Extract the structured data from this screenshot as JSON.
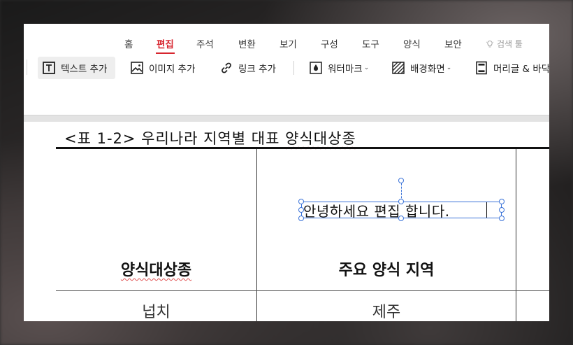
{
  "tabs": [
    {
      "label": "홈"
    },
    {
      "label": "편집"
    },
    {
      "label": "주석"
    },
    {
      "label": "변환"
    },
    {
      "label": "보기"
    },
    {
      "label": "구성"
    },
    {
      "label": "도구"
    },
    {
      "label": "양식"
    },
    {
      "label": "보안"
    }
  ],
  "search_label": "검색 툴",
  "toolbar": {
    "add_text": "텍스트 추가",
    "add_image": "이미지 추가",
    "add_link": "링크 추가",
    "watermark": "워터마크",
    "background": "배경화면",
    "header_footer": "머리글 & 바닥"
  },
  "document": {
    "caption_prefix": "<표 1-2> 우리나라 지역별 대표 ",
    "caption_word": "양식대상종",
    "table": {
      "headers": [
        "양식대상종",
        "주요 양식 지역"
      ],
      "rows": [
        [
          "넙치",
          "제주"
        ]
      ]
    },
    "textbox_text": "안녕하세요 편집 합니다."
  },
  "colors": {
    "accent": "#d7262f",
    "selection": "#3b73d8"
  },
  "icons": {
    "search": "lightbulb-icon",
    "add_text": "text-box-icon",
    "add_image": "image-icon",
    "add_link": "link-icon",
    "watermark": "drop-icon",
    "background": "hatched-square-icon",
    "header_footer": "header-footer-icon"
  }
}
